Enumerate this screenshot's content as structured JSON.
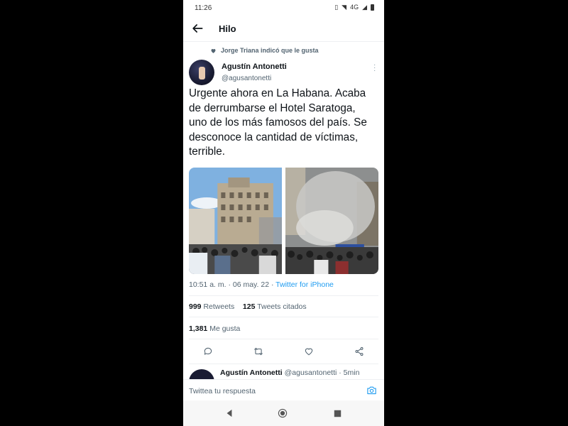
{
  "status": {
    "time": "11:26",
    "network": "4G"
  },
  "header": {
    "title": "Hilo"
  },
  "context": {
    "liked_by": "Jorge Triana indicó que le gusta"
  },
  "tweet": {
    "author_name": "Agustín Antonetti",
    "author_handle": "@agusantonetti",
    "text": "Urgente ahora en La Habana. Acaba de derrumbarse el Hotel Saratoga, uno de los más famosos del país. Se desconoce la cantidad de víctimas, terrible.",
    "time": "10:51 a. m. · 06 may. 22 · ",
    "source": "Twitter for iPhone",
    "retweets_count": "999",
    "retweets_label": "Retweets",
    "quotes_count": "125",
    "quotes_label": "Tweets citados",
    "likes_count": "1,381",
    "likes_label": "Me gusta"
  },
  "reply": {
    "author_name": "Agustín Antonetti",
    "author_handle": "@agusantonetti",
    "age": "· 5min"
  },
  "composer": {
    "placeholder": "Twittea tu respuesta"
  },
  "icons": {
    "back": "arrow-left-icon",
    "reply": "comment-icon",
    "retweet": "retweet-icon",
    "like": "heart-icon",
    "share": "share-icon",
    "camera": "camera-icon"
  },
  "colors": {
    "accent": "#1d9bf0",
    "secondary_text": "#536471"
  }
}
